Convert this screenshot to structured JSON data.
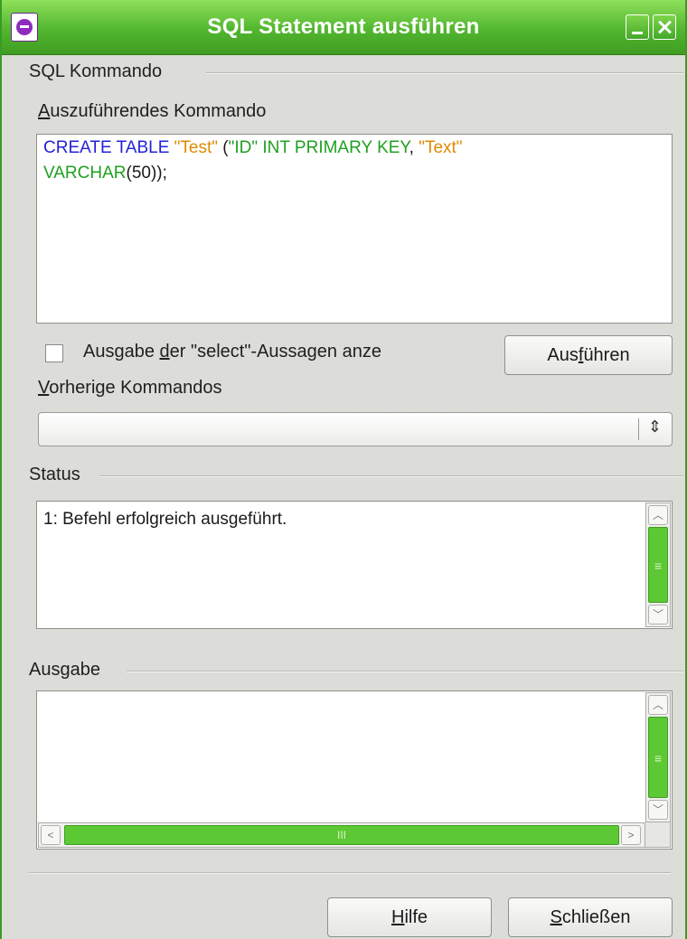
{
  "window": {
    "title": "SQL Statement ausführen"
  },
  "sql_group": {
    "heading": "SQL Kommando",
    "command_label_prefix": "",
    "command_label_mnemonic": "A",
    "command_label_rest": "uszuführendes Kommando",
    "command_tokens": [
      {
        "text": "CREATE TABLE ",
        "kind": "keyword"
      },
      {
        "text": "\"Test\"",
        "kind": "string"
      },
      {
        "text": " (",
        "kind": "plain"
      },
      {
        "text": "\"ID\" INT PRIMARY KEY",
        "kind": "field"
      },
      {
        "text": ", ",
        "kind": "plain"
      },
      {
        "text": "\"Text\"",
        "kind": "string"
      },
      {
        "text": "\n",
        "kind": "plain"
      },
      {
        "text": "VARCHAR",
        "kind": "field"
      },
      {
        "text": "(50));",
        "kind": "plain"
      }
    ],
    "checkbox_label_prefix": "Ausgabe ",
    "checkbox_label_mnemonic": "d",
    "checkbox_label_rest": "er \"select\"-Aussagen anze",
    "checkbox_checked": false,
    "execute_prefix": "Aus",
    "execute_mnemonic": "f",
    "execute_rest": "ühren",
    "previous_label_mnemonic": "V",
    "previous_label_rest": "orherige Kommandos",
    "previous_value": ""
  },
  "status_group": {
    "heading": "Status",
    "text": "1: Befehl erfolgreich ausgeführt."
  },
  "output_group": {
    "heading": "Ausgabe",
    "text": ""
  },
  "buttons": {
    "help_mnemonic": "H",
    "help_rest": "ilfe",
    "close_mnemonic": "S",
    "close_rest": "chließen"
  },
  "colors": {
    "keyword": "#2323d6",
    "string": "#e08a00",
    "field": "#20a020",
    "titlebar": "#52b62f"
  }
}
